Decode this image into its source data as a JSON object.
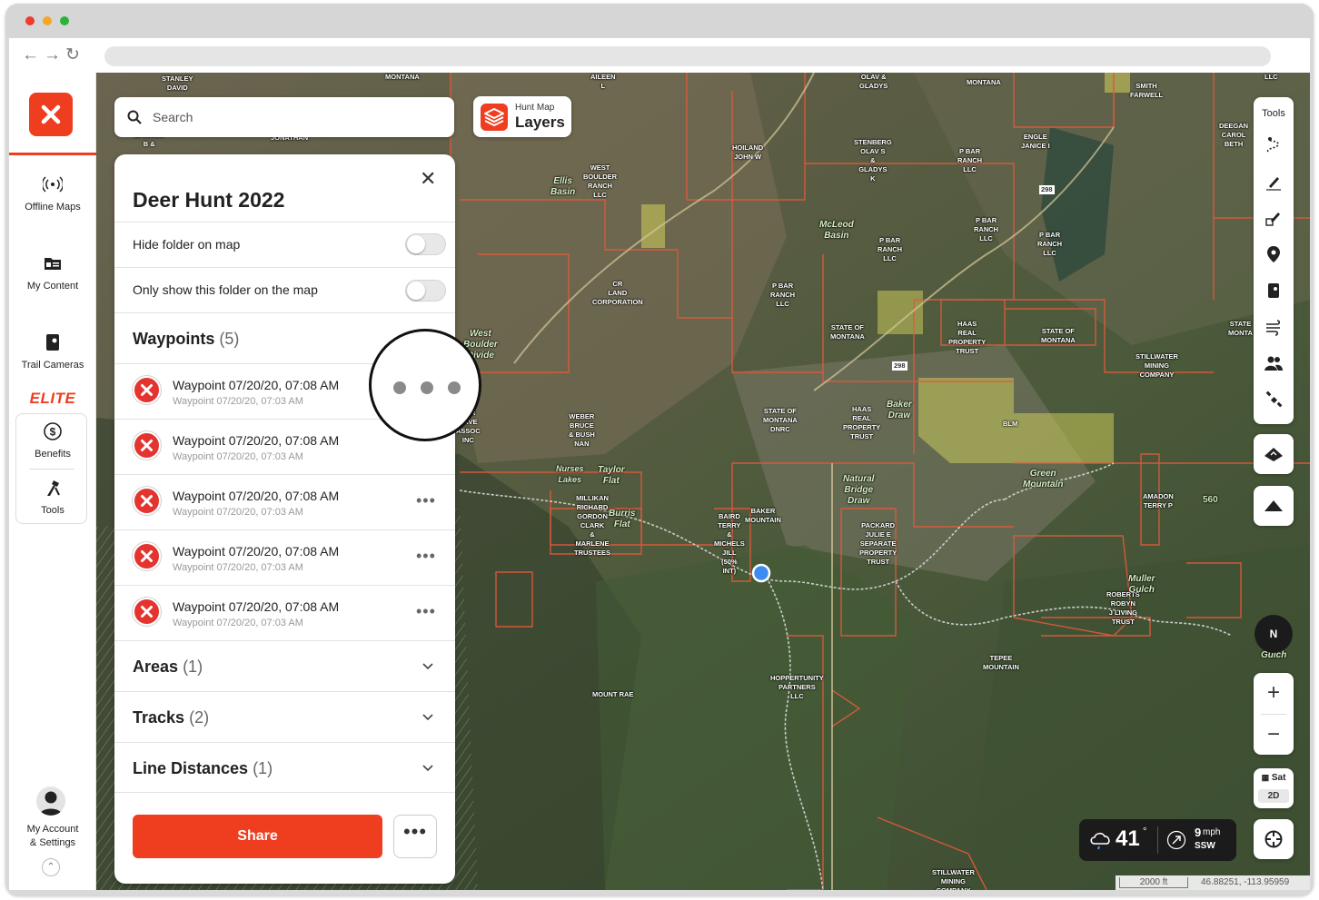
{
  "sidebar": {
    "items": [
      {
        "label": "Offline Maps",
        "icon": "offline-maps-icon"
      },
      {
        "label": "My Content",
        "icon": "my-content-icon"
      },
      {
        "label": "Trail Cameras",
        "icon": "trail-camera-icon"
      }
    ],
    "elite_badge": "ELITE",
    "elite_items": [
      {
        "label": "Benefits",
        "icon": "dollar-icon"
      },
      {
        "label": "Tools",
        "icon": "tools-icon"
      }
    ],
    "account_line1": "My Account",
    "account_line2": "& Settings"
  },
  "search": {
    "placeholder": "Search"
  },
  "layers": {
    "small": "Hunt Map",
    "big": "Layers"
  },
  "panel": {
    "title": "Deer Hunt 2022",
    "hide_folder_label": "Hide folder on map",
    "hide_folder_on": false,
    "only_show_label": "Only show this folder on the map",
    "only_show_on": false,
    "waypoints": {
      "label": "Waypoints",
      "count": "(5)"
    },
    "waypoint_items": [
      {
        "title": "Waypoint 07/20/20, 07:08 AM",
        "subtitle": "Waypoint 07/20/20, 07:03 AM"
      },
      {
        "title": "Waypoint 07/20/20, 07:08 AM",
        "subtitle": "Waypoint 07/20/20, 07:03 AM"
      },
      {
        "title": "Waypoint 07/20/20, 07:08 AM",
        "subtitle": "Waypoint 07/20/20, 07:03 AM"
      },
      {
        "title": "Waypoint 07/20/20, 07:08 AM",
        "subtitle": "Waypoint 07/20/20, 07:03 AM"
      },
      {
        "title": "Waypoint 07/20/20, 07:08 AM",
        "subtitle": "Waypoint 07/20/20, 07:03 AM"
      }
    ],
    "areas": {
      "label": "Areas",
      "count": "(1)"
    },
    "tracks": {
      "label": "Tracks",
      "count": "(2)"
    },
    "line_distances": {
      "label": "Line Distances",
      "count": "(1)"
    },
    "share_label": "Share"
  },
  "tools": {
    "label": "Tools"
  },
  "compass": {
    "label": "N"
  },
  "basemap": {
    "label": "Sat",
    "mode": "2D"
  },
  "weather": {
    "temp": "41",
    "degree": "°",
    "wind_speed": "9",
    "wind_unit": "mph",
    "wind_dir": "SSW"
  },
  "scale": {
    "distance": "2000 ft",
    "coords": "46.88251, -113.95959"
  },
  "map_labels": [
    {
      "text": "STANLEY\nDAVID"
    },
    {
      "text": "MONTANA"
    },
    {
      "text": "AILEEN\nL"
    },
    {
      "text": "OLAV &\nGLADYS"
    },
    {
      "text": "MONTANA"
    },
    {
      "text": "SMITH\nFARWELL"
    },
    {
      "text": "LLC"
    },
    {
      "text": "BANNOS\nB &"
    },
    {
      "text": "JONATHAN"
    },
    {
      "text": "HOILAND\nJOHN W"
    },
    {
      "text": "STENBERG\nOLAV S\n&\nGLADYS\nK"
    },
    {
      "text": "P BAR\nRANCH\nLLC"
    },
    {
      "text": "ENGLE\nJANICE I"
    },
    {
      "text": "DEEGAN\nCAROL\nBETH"
    },
    {
      "text": "WEST\nBOULDER\nRANCH\nLLC"
    },
    {
      "text": "Ellis\nBasin"
    },
    {
      "text": "McLeod\nBasin"
    },
    {
      "text": "P BAR\nRANCH\nLLC"
    },
    {
      "text": "P BAR\nRANCH\nLLC"
    },
    {
      "text": "P BAR\nRANCH\nLLC"
    },
    {
      "text": "CR\nLAND\nCORPORATION"
    },
    {
      "text": "P BAR\nRANCH\nLLC"
    },
    {
      "text": "STATE OF\nMONTANA"
    },
    {
      "text": "HAAS\nREAL\nPROPERTY\nTRUST"
    },
    {
      "text": "STATE OF\nMONTANA"
    },
    {
      "text": "STATE\nMONTA"
    },
    {
      "text": "STILLWATER\nMINING\nCOMPANY"
    },
    {
      "text": "West\nBoulder\nDivide"
    },
    {
      "text": "WEBER\nBRUCE\n& BUSH\nNAN"
    },
    {
      "text": "STATE OF\nMONTANA\nDNRC"
    },
    {
      "text": "HAAS\nREAL\nPROPERTY\nTRUST"
    },
    {
      "text": "Baker\nDraw"
    },
    {
      "text": "BLM"
    },
    {
      "text": "Nurses\nLakes"
    },
    {
      "text": "Taylor\nFlat"
    },
    {
      "text": "Green\nMountain"
    },
    {
      "text": "Natural\nBridge\nDraw"
    },
    {
      "text": "AMADON\nTERRY P"
    },
    {
      "text": "560"
    },
    {
      "text": "MILLIKAN\nRICHARD\nGORDON\nCLARK\n&\nMARLENE\nTRUSTEES"
    },
    {
      "text": "Burris\nFlat"
    },
    {
      "text": "BAIRD\nTERRY\n&\nMICHELS\nJILL\n(50%\nINT)"
    },
    {
      "text": "Baker\nMountain"
    },
    {
      "text": "PACKARD\nJULIE E\nSEPARATE\nPROPERTY\nTRUST"
    },
    {
      "text": "ROBERTS\nROBYN\nJ LIVING\nTRUST"
    },
    {
      "text": "Muller\nGulch"
    },
    {
      "text": "Tepee\nMountain"
    },
    {
      "text": "HOPPERTUNITY\nPARTNERS\nLLC"
    },
    {
      "text": "Mount Rae"
    },
    {
      "text": "Gulch"
    },
    {
      "text": "STILLWATER\nMINING\nCOMPANY"
    },
    {
      "text": "298"
    },
    {
      "text": "298"
    },
    {
      "text": "GER\nERVE\nASSOC\nINC"
    }
  ]
}
